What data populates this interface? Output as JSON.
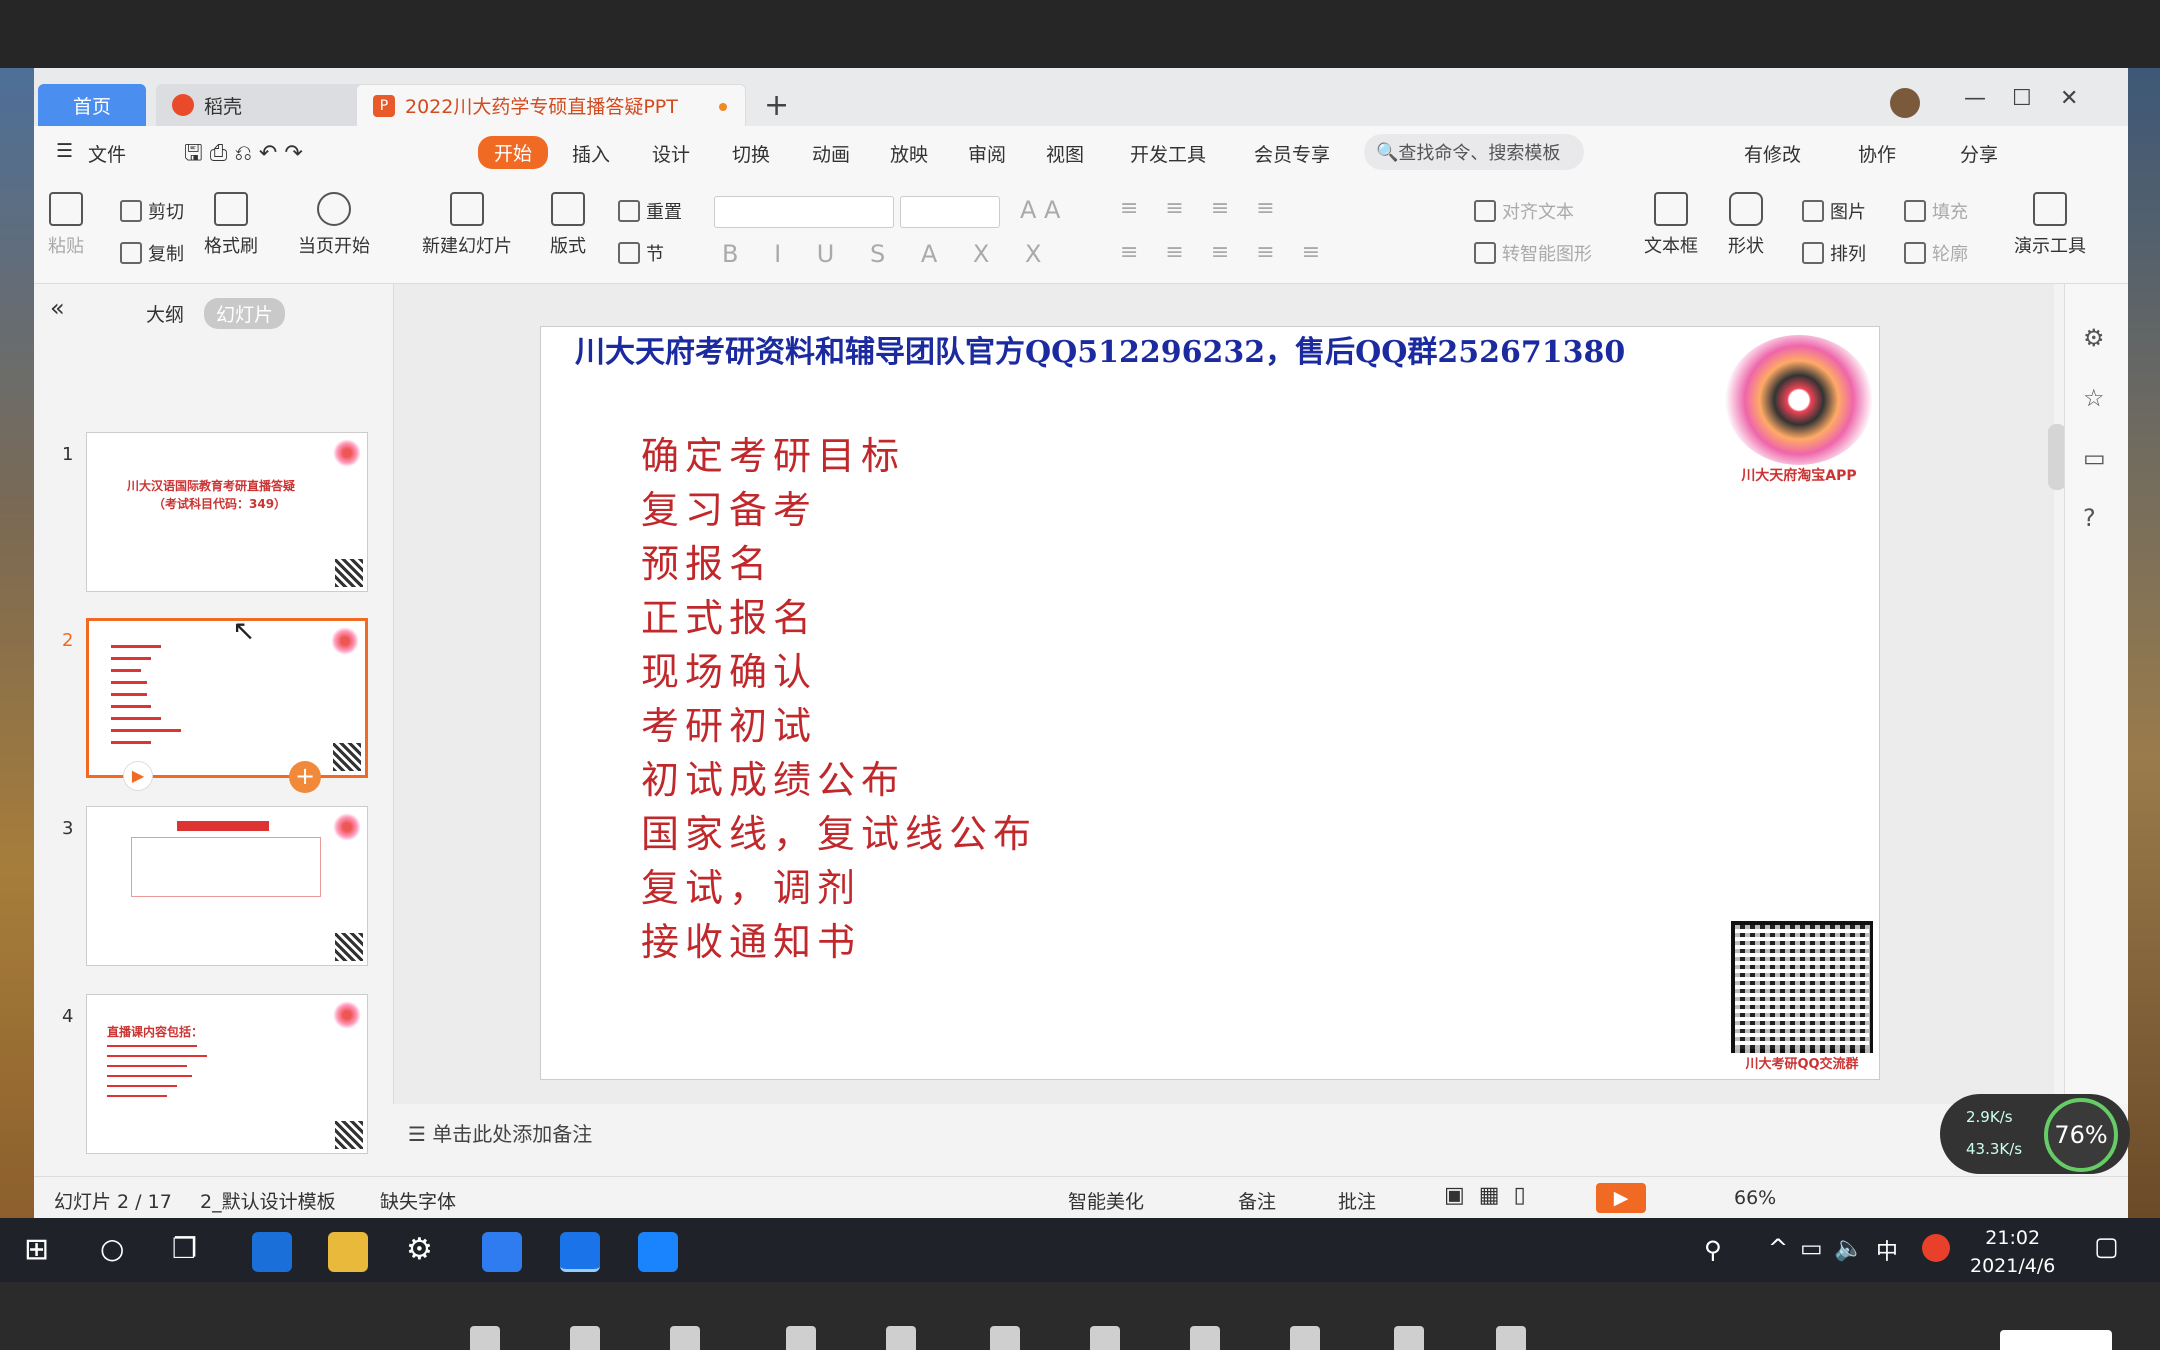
{
  "window": {
    "tabs": {
      "home": "首页",
      "wps": "稻壳",
      "doc": "2022川大药学专硕直播答疑PPT"
    },
    "tab_add": "+",
    "controls": {
      "min": "—",
      "max": "☐",
      "close": "✕"
    }
  },
  "menu": {
    "file": "文件",
    "items": [
      "开始",
      "插入",
      "设计",
      "切换",
      "动画",
      "放映",
      "审阅",
      "视图",
      "开发工具",
      "会员专享"
    ],
    "search_placeholder": "查找命令、搜索模板",
    "right": {
      "modify": "有修改",
      "collab": "协作",
      "share": "分享"
    }
  },
  "ribbon": {
    "paste": "粘贴",
    "cut": "剪切",
    "copy": "复制",
    "format_painter": "格式刷",
    "from_current": "当页开始",
    "new_slide": "新建幻灯片",
    "layout": "版式",
    "reset": "重置",
    "section": "节",
    "align_text": "对齐文本",
    "convert": "转智能图形",
    "textbox": "文本框",
    "shape": "形状",
    "picture": "图片",
    "fill": "填充",
    "arrange": "排列",
    "outline": "轮廓",
    "present_tools": "演示工具"
  },
  "left_panel": {
    "tabs": {
      "outline": "大纲",
      "slides": "幻灯片"
    },
    "thumbnails": [
      {
        "num": "1",
        "title": "川大汉语国际教育考研直播答疑",
        "sub": "（考试科目代码：349）"
      },
      {
        "num": "2"
      },
      {
        "num": "3"
      },
      {
        "num": "4",
        "title": "直播课内容包括："
      }
    ],
    "add": "+"
  },
  "slide": {
    "header": "川大天府考研资料和辅导团队官方QQ512296232，售后QQ群252671380",
    "items": [
      "确定考研目标",
      "复习备考",
      "预报名",
      "正式报名",
      "现场确认",
      "考研初试",
      "初试成绩公布",
      "国家线，复试线公布",
      "复试，调剂",
      "接收通知书"
    ],
    "qr1_label": "川大天府淘宝APP",
    "qr2_label": "川大考研QQ交流群"
  },
  "notes_placeholder": "单击此处添加备注",
  "statusbar": {
    "slide_info": "幻灯片 2 / 17",
    "template": "2_默认设计模板",
    "missing_font": "缺失字体",
    "beautify": "智能美化",
    "notes": "备注",
    "comment": "批注",
    "zoom": "66%"
  },
  "net_widget": {
    "up": "2.9K/s",
    "down": "43.3K/s",
    "percent": "76%"
  },
  "taskbar": {
    "time": "21:02",
    "date": "2021/4/6",
    "ime": "中"
  },
  "colors": {
    "accent": "#f06a24",
    "tab_home": "#4a8ef0",
    "slide_header": "#1b2a9e",
    "slide_text": "#c0282b"
  }
}
